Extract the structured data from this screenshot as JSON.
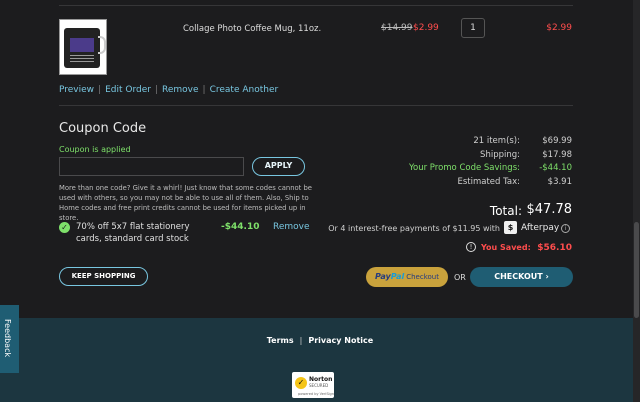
{
  "cart_item": {
    "name": "Collage Photo Coffee Mug, 11oz.",
    "original_price": "$14.99",
    "price": "$2.99",
    "quantity": "1",
    "line_total": "$2.99",
    "actions": [
      "Preview",
      "Edit Order",
      "Remove",
      "Create Another"
    ]
  },
  "coupon": {
    "title": "Coupon Code",
    "applied_text": "Coupon is applied",
    "input_value": "",
    "apply_label": "APPLY",
    "note": "More than one code? Give it a whirl! Just know that some codes cannot be used with others, so you may not be able to use all of them. Also, Ship to Home codes and free print credits cannot be used for items picked up in store.",
    "applied_promo": {
      "description": "70% off 5x7 flat stationery cards, standard card stock",
      "amount": "-$44.10",
      "remove_label": "Remove"
    }
  },
  "summary": {
    "items_label": "21 item(s):",
    "items_value": "$69.99",
    "shipping_label": "Shipping:",
    "shipping_value": "$17.98",
    "promo_label": "Your Promo Code Savings:",
    "promo_value": "-$44.10",
    "tax_label": "Estimated Tax:",
    "tax_value": "$3.91",
    "total_label": "Total:",
    "total_value": "$47.78",
    "installments_text": "Or 4 interest-free payments of $11.95 with",
    "afterpay_label": "Afterpay",
    "saved_label": "You Saved:",
    "saved_value": "$56.10"
  },
  "actions": {
    "keep_shopping": "KEEP SHOPPING",
    "paypal_brand_1": "Pay",
    "paypal_brand_2": "Pal",
    "paypal_checkout": "Checkout",
    "or": "OR",
    "checkout": "CHECKOUT ›"
  },
  "footer": {
    "links": [
      "Terms",
      "Privacy Notice"
    ],
    "norton_title": "Norton",
    "norton_sub": "SECURED",
    "norton_by": "powered by VeriSign"
  },
  "feedback_tab": "Feedback",
  "colors": {
    "background": "#1c1c1e",
    "accent_blue": "#78c6e0",
    "price_red": "#ff4d4d",
    "savings_green": "#7ee06a",
    "checkout_teal": "#1f5d73",
    "footer_bg": "#1c3640"
  }
}
